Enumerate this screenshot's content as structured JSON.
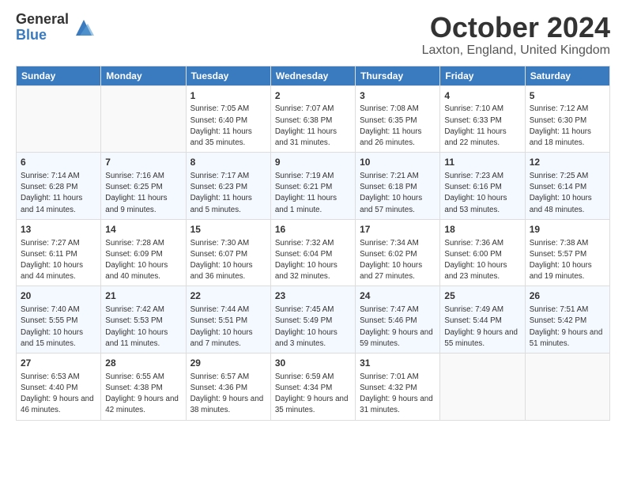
{
  "logo": {
    "general": "General",
    "blue": "Blue"
  },
  "title": "October 2024",
  "location": "Laxton, England, United Kingdom",
  "days_of_week": [
    "Sunday",
    "Monday",
    "Tuesday",
    "Wednesday",
    "Thursday",
    "Friday",
    "Saturday"
  ],
  "weeks": [
    [
      {
        "day": "",
        "info": ""
      },
      {
        "day": "",
        "info": ""
      },
      {
        "day": "1",
        "sunrise": "Sunrise: 7:05 AM",
        "sunset": "Sunset: 6:40 PM",
        "daylight": "Daylight: 11 hours and 35 minutes."
      },
      {
        "day": "2",
        "sunrise": "Sunrise: 7:07 AM",
        "sunset": "Sunset: 6:38 PM",
        "daylight": "Daylight: 11 hours and 31 minutes."
      },
      {
        "day": "3",
        "sunrise": "Sunrise: 7:08 AM",
        "sunset": "Sunset: 6:35 PM",
        "daylight": "Daylight: 11 hours and 26 minutes."
      },
      {
        "day": "4",
        "sunrise": "Sunrise: 7:10 AM",
        "sunset": "Sunset: 6:33 PM",
        "daylight": "Daylight: 11 hours and 22 minutes."
      },
      {
        "day": "5",
        "sunrise": "Sunrise: 7:12 AM",
        "sunset": "Sunset: 6:30 PM",
        "daylight": "Daylight: 11 hours and 18 minutes."
      }
    ],
    [
      {
        "day": "6",
        "sunrise": "Sunrise: 7:14 AM",
        "sunset": "Sunset: 6:28 PM",
        "daylight": "Daylight: 11 hours and 14 minutes."
      },
      {
        "day": "7",
        "sunrise": "Sunrise: 7:16 AM",
        "sunset": "Sunset: 6:25 PM",
        "daylight": "Daylight: 11 hours and 9 minutes."
      },
      {
        "day": "8",
        "sunrise": "Sunrise: 7:17 AM",
        "sunset": "Sunset: 6:23 PM",
        "daylight": "Daylight: 11 hours and 5 minutes."
      },
      {
        "day": "9",
        "sunrise": "Sunrise: 7:19 AM",
        "sunset": "Sunset: 6:21 PM",
        "daylight": "Daylight: 11 hours and 1 minute."
      },
      {
        "day": "10",
        "sunrise": "Sunrise: 7:21 AM",
        "sunset": "Sunset: 6:18 PM",
        "daylight": "Daylight: 10 hours and 57 minutes."
      },
      {
        "day": "11",
        "sunrise": "Sunrise: 7:23 AM",
        "sunset": "Sunset: 6:16 PM",
        "daylight": "Daylight: 10 hours and 53 minutes."
      },
      {
        "day": "12",
        "sunrise": "Sunrise: 7:25 AM",
        "sunset": "Sunset: 6:14 PM",
        "daylight": "Daylight: 10 hours and 48 minutes."
      }
    ],
    [
      {
        "day": "13",
        "sunrise": "Sunrise: 7:27 AM",
        "sunset": "Sunset: 6:11 PM",
        "daylight": "Daylight: 10 hours and 44 minutes."
      },
      {
        "day": "14",
        "sunrise": "Sunrise: 7:28 AM",
        "sunset": "Sunset: 6:09 PM",
        "daylight": "Daylight: 10 hours and 40 minutes."
      },
      {
        "day": "15",
        "sunrise": "Sunrise: 7:30 AM",
        "sunset": "Sunset: 6:07 PM",
        "daylight": "Daylight: 10 hours and 36 minutes."
      },
      {
        "day": "16",
        "sunrise": "Sunrise: 7:32 AM",
        "sunset": "Sunset: 6:04 PM",
        "daylight": "Daylight: 10 hours and 32 minutes."
      },
      {
        "day": "17",
        "sunrise": "Sunrise: 7:34 AM",
        "sunset": "Sunset: 6:02 PM",
        "daylight": "Daylight: 10 hours and 27 minutes."
      },
      {
        "day": "18",
        "sunrise": "Sunrise: 7:36 AM",
        "sunset": "Sunset: 6:00 PM",
        "daylight": "Daylight: 10 hours and 23 minutes."
      },
      {
        "day": "19",
        "sunrise": "Sunrise: 7:38 AM",
        "sunset": "Sunset: 5:57 PM",
        "daylight": "Daylight: 10 hours and 19 minutes."
      }
    ],
    [
      {
        "day": "20",
        "sunrise": "Sunrise: 7:40 AM",
        "sunset": "Sunset: 5:55 PM",
        "daylight": "Daylight: 10 hours and 15 minutes."
      },
      {
        "day": "21",
        "sunrise": "Sunrise: 7:42 AM",
        "sunset": "Sunset: 5:53 PM",
        "daylight": "Daylight: 10 hours and 11 minutes."
      },
      {
        "day": "22",
        "sunrise": "Sunrise: 7:44 AM",
        "sunset": "Sunset: 5:51 PM",
        "daylight": "Daylight: 10 hours and 7 minutes."
      },
      {
        "day": "23",
        "sunrise": "Sunrise: 7:45 AM",
        "sunset": "Sunset: 5:49 PM",
        "daylight": "Daylight: 10 hours and 3 minutes."
      },
      {
        "day": "24",
        "sunrise": "Sunrise: 7:47 AM",
        "sunset": "Sunset: 5:46 PM",
        "daylight": "Daylight: 9 hours and 59 minutes."
      },
      {
        "day": "25",
        "sunrise": "Sunrise: 7:49 AM",
        "sunset": "Sunset: 5:44 PM",
        "daylight": "Daylight: 9 hours and 55 minutes."
      },
      {
        "day": "26",
        "sunrise": "Sunrise: 7:51 AM",
        "sunset": "Sunset: 5:42 PM",
        "daylight": "Daylight: 9 hours and 51 minutes."
      }
    ],
    [
      {
        "day": "27",
        "sunrise": "Sunrise: 6:53 AM",
        "sunset": "Sunset: 4:40 PM",
        "daylight": "Daylight: 9 hours and 46 minutes."
      },
      {
        "day": "28",
        "sunrise": "Sunrise: 6:55 AM",
        "sunset": "Sunset: 4:38 PM",
        "daylight": "Daylight: 9 hours and 42 minutes."
      },
      {
        "day": "29",
        "sunrise": "Sunrise: 6:57 AM",
        "sunset": "Sunset: 4:36 PM",
        "daylight": "Daylight: 9 hours and 38 minutes."
      },
      {
        "day": "30",
        "sunrise": "Sunrise: 6:59 AM",
        "sunset": "Sunset: 4:34 PM",
        "daylight": "Daylight: 9 hours and 35 minutes."
      },
      {
        "day": "31",
        "sunrise": "Sunrise: 7:01 AM",
        "sunset": "Sunset: 4:32 PM",
        "daylight": "Daylight: 9 hours and 31 minutes."
      },
      {
        "day": "",
        "info": ""
      },
      {
        "day": "",
        "info": ""
      }
    ]
  ]
}
